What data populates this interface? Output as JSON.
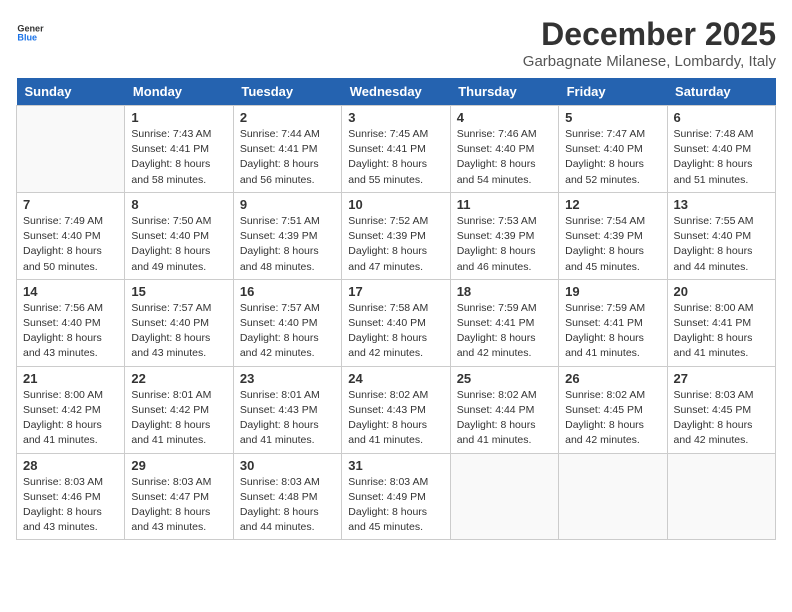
{
  "header": {
    "logo_line1": "General",
    "logo_line2": "Blue",
    "month": "December 2025",
    "location": "Garbagnate Milanese, Lombardy, Italy"
  },
  "weekdays": [
    "Sunday",
    "Monday",
    "Tuesday",
    "Wednesday",
    "Thursday",
    "Friday",
    "Saturday"
  ],
  "weeks": [
    [
      {
        "day": "",
        "info": ""
      },
      {
        "day": "1",
        "info": "Sunrise: 7:43 AM\nSunset: 4:41 PM\nDaylight: 8 hours\nand 58 minutes."
      },
      {
        "day": "2",
        "info": "Sunrise: 7:44 AM\nSunset: 4:41 PM\nDaylight: 8 hours\nand 56 minutes."
      },
      {
        "day": "3",
        "info": "Sunrise: 7:45 AM\nSunset: 4:41 PM\nDaylight: 8 hours\nand 55 minutes."
      },
      {
        "day": "4",
        "info": "Sunrise: 7:46 AM\nSunset: 4:40 PM\nDaylight: 8 hours\nand 54 minutes."
      },
      {
        "day": "5",
        "info": "Sunrise: 7:47 AM\nSunset: 4:40 PM\nDaylight: 8 hours\nand 52 minutes."
      },
      {
        "day": "6",
        "info": "Sunrise: 7:48 AM\nSunset: 4:40 PM\nDaylight: 8 hours\nand 51 minutes."
      }
    ],
    [
      {
        "day": "7",
        "info": "Sunrise: 7:49 AM\nSunset: 4:40 PM\nDaylight: 8 hours\nand 50 minutes."
      },
      {
        "day": "8",
        "info": "Sunrise: 7:50 AM\nSunset: 4:40 PM\nDaylight: 8 hours\nand 49 minutes."
      },
      {
        "day": "9",
        "info": "Sunrise: 7:51 AM\nSunset: 4:39 PM\nDaylight: 8 hours\nand 48 minutes."
      },
      {
        "day": "10",
        "info": "Sunrise: 7:52 AM\nSunset: 4:39 PM\nDaylight: 8 hours\nand 47 minutes."
      },
      {
        "day": "11",
        "info": "Sunrise: 7:53 AM\nSunset: 4:39 PM\nDaylight: 8 hours\nand 46 minutes."
      },
      {
        "day": "12",
        "info": "Sunrise: 7:54 AM\nSunset: 4:39 PM\nDaylight: 8 hours\nand 45 minutes."
      },
      {
        "day": "13",
        "info": "Sunrise: 7:55 AM\nSunset: 4:40 PM\nDaylight: 8 hours\nand 44 minutes."
      }
    ],
    [
      {
        "day": "14",
        "info": "Sunrise: 7:56 AM\nSunset: 4:40 PM\nDaylight: 8 hours\nand 43 minutes."
      },
      {
        "day": "15",
        "info": "Sunrise: 7:57 AM\nSunset: 4:40 PM\nDaylight: 8 hours\nand 43 minutes."
      },
      {
        "day": "16",
        "info": "Sunrise: 7:57 AM\nSunset: 4:40 PM\nDaylight: 8 hours\nand 42 minutes."
      },
      {
        "day": "17",
        "info": "Sunrise: 7:58 AM\nSunset: 4:40 PM\nDaylight: 8 hours\nand 42 minutes."
      },
      {
        "day": "18",
        "info": "Sunrise: 7:59 AM\nSunset: 4:41 PM\nDaylight: 8 hours\nand 42 minutes."
      },
      {
        "day": "19",
        "info": "Sunrise: 7:59 AM\nSunset: 4:41 PM\nDaylight: 8 hours\nand 41 minutes."
      },
      {
        "day": "20",
        "info": "Sunrise: 8:00 AM\nSunset: 4:41 PM\nDaylight: 8 hours\nand 41 minutes."
      }
    ],
    [
      {
        "day": "21",
        "info": "Sunrise: 8:00 AM\nSunset: 4:42 PM\nDaylight: 8 hours\nand 41 minutes."
      },
      {
        "day": "22",
        "info": "Sunrise: 8:01 AM\nSunset: 4:42 PM\nDaylight: 8 hours\nand 41 minutes."
      },
      {
        "day": "23",
        "info": "Sunrise: 8:01 AM\nSunset: 4:43 PM\nDaylight: 8 hours\nand 41 minutes."
      },
      {
        "day": "24",
        "info": "Sunrise: 8:02 AM\nSunset: 4:43 PM\nDaylight: 8 hours\nand 41 minutes."
      },
      {
        "day": "25",
        "info": "Sunrise: 8:02 AM\nSunset: 4:44 PM\nDaylight: 8 hours\nand 41 minutes."
      },
      {
        "day": "26",
        "info": "Sunrise: 8:02 AM\nSunset: 4:45 PM\nDaylight: 8 hours\nand 42 minutes."
      },
      {
        "day": "27",
        "info": "Sunrise: 8:03 AM\nSunset: 4:45 PM\nDaylight: 8 hours\nand 42 minutes."
      }
    ],
    [
      {
        "day": "28",
        "info": "Sunrise: 8:03 AM\nSunset: 4:46 PM\nDaylight: 8 hours\nand 43 minutes."
      },
      {
        "day": "29",
        "info": "Sunrise: 8:03 AM\nSunset: 4:47 PM\nDaylight: 8 hours\nand 43 minutes."
      },
      {
        "day": "30",
        "info": "Sunrise: 8:03 AM\nSunset: 4:48 PM\nDaylight: 8 hours\nand 44 minutes."
      },
      {
        "day": "31",
        "info": "Sunrise: 8:03 AM\nSunset: 4:49 PM\nDaylight: 8 hours\nand 45 minutes."
      },
      {
        "day": "",
        "info": ""
      },
      {
        "day": "",
        "info": ""
      },
      {
        "day": "",
        "info": ""
      }
    ]
  ]
}
